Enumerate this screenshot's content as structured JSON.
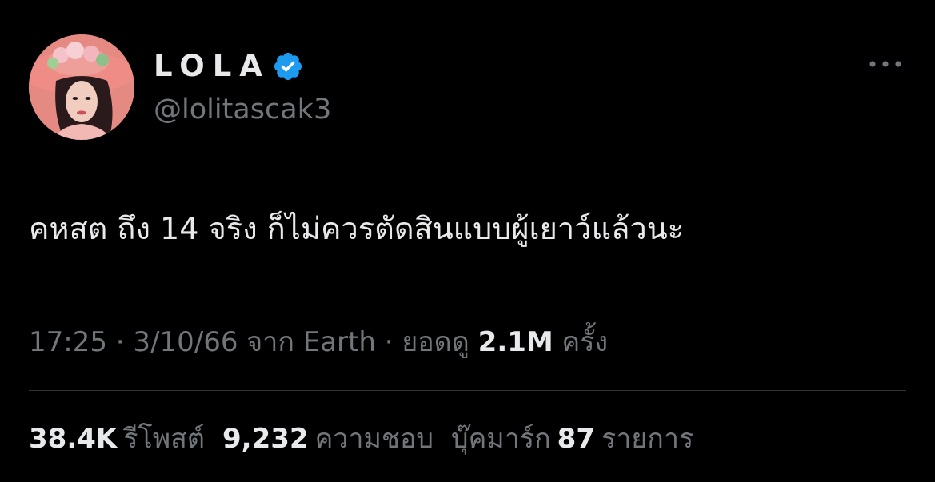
{
  "user": {
    "display_name": "LOLA",
    "handle": "@lolitascak3",
    "verified_icon": "verified-badge-icon",
    "verified_color": "#1d9bf0"
  },
  "menu": {
    "more_icon": "more-horizontal-icon"
  },
  "tweet": {
    "text": "คหสต ถึง 14 จริง ก็ไม่ควรตัดสินแบบผู้เยาว์แล้วนะ"
  },
  "meta": {
    "time": "17:25",
    "sep1": " · ",
    "date": "3/10/66",
    "from_label": " จาก ",
    "source": "Earth",
    "sep2": " · ",
    "views_label": "ยอดดู ",
    "views_count": "2.1M",
    "views_unit": " ครั้ง"
  },
  "stats": {
    "reposts_count": "38.4K",
    "reposts_label": "รีโพสต์",
    "likes_count": "9,232",
    "likes_label": "ความชอบ",
    "bookmarks_label": "บุ๊คมาร์ก",
    "bookmarks_count": "87",
    "bookmarks_unit": "รายการ"
  },
  "colors": {
    "background": "#000000",
    "primary_text": "#e7e9ea",
    "secondary_text": "#71767b",
    "divider": "#2f3336",
    "accent": "#1d9bf0"
  }
}
